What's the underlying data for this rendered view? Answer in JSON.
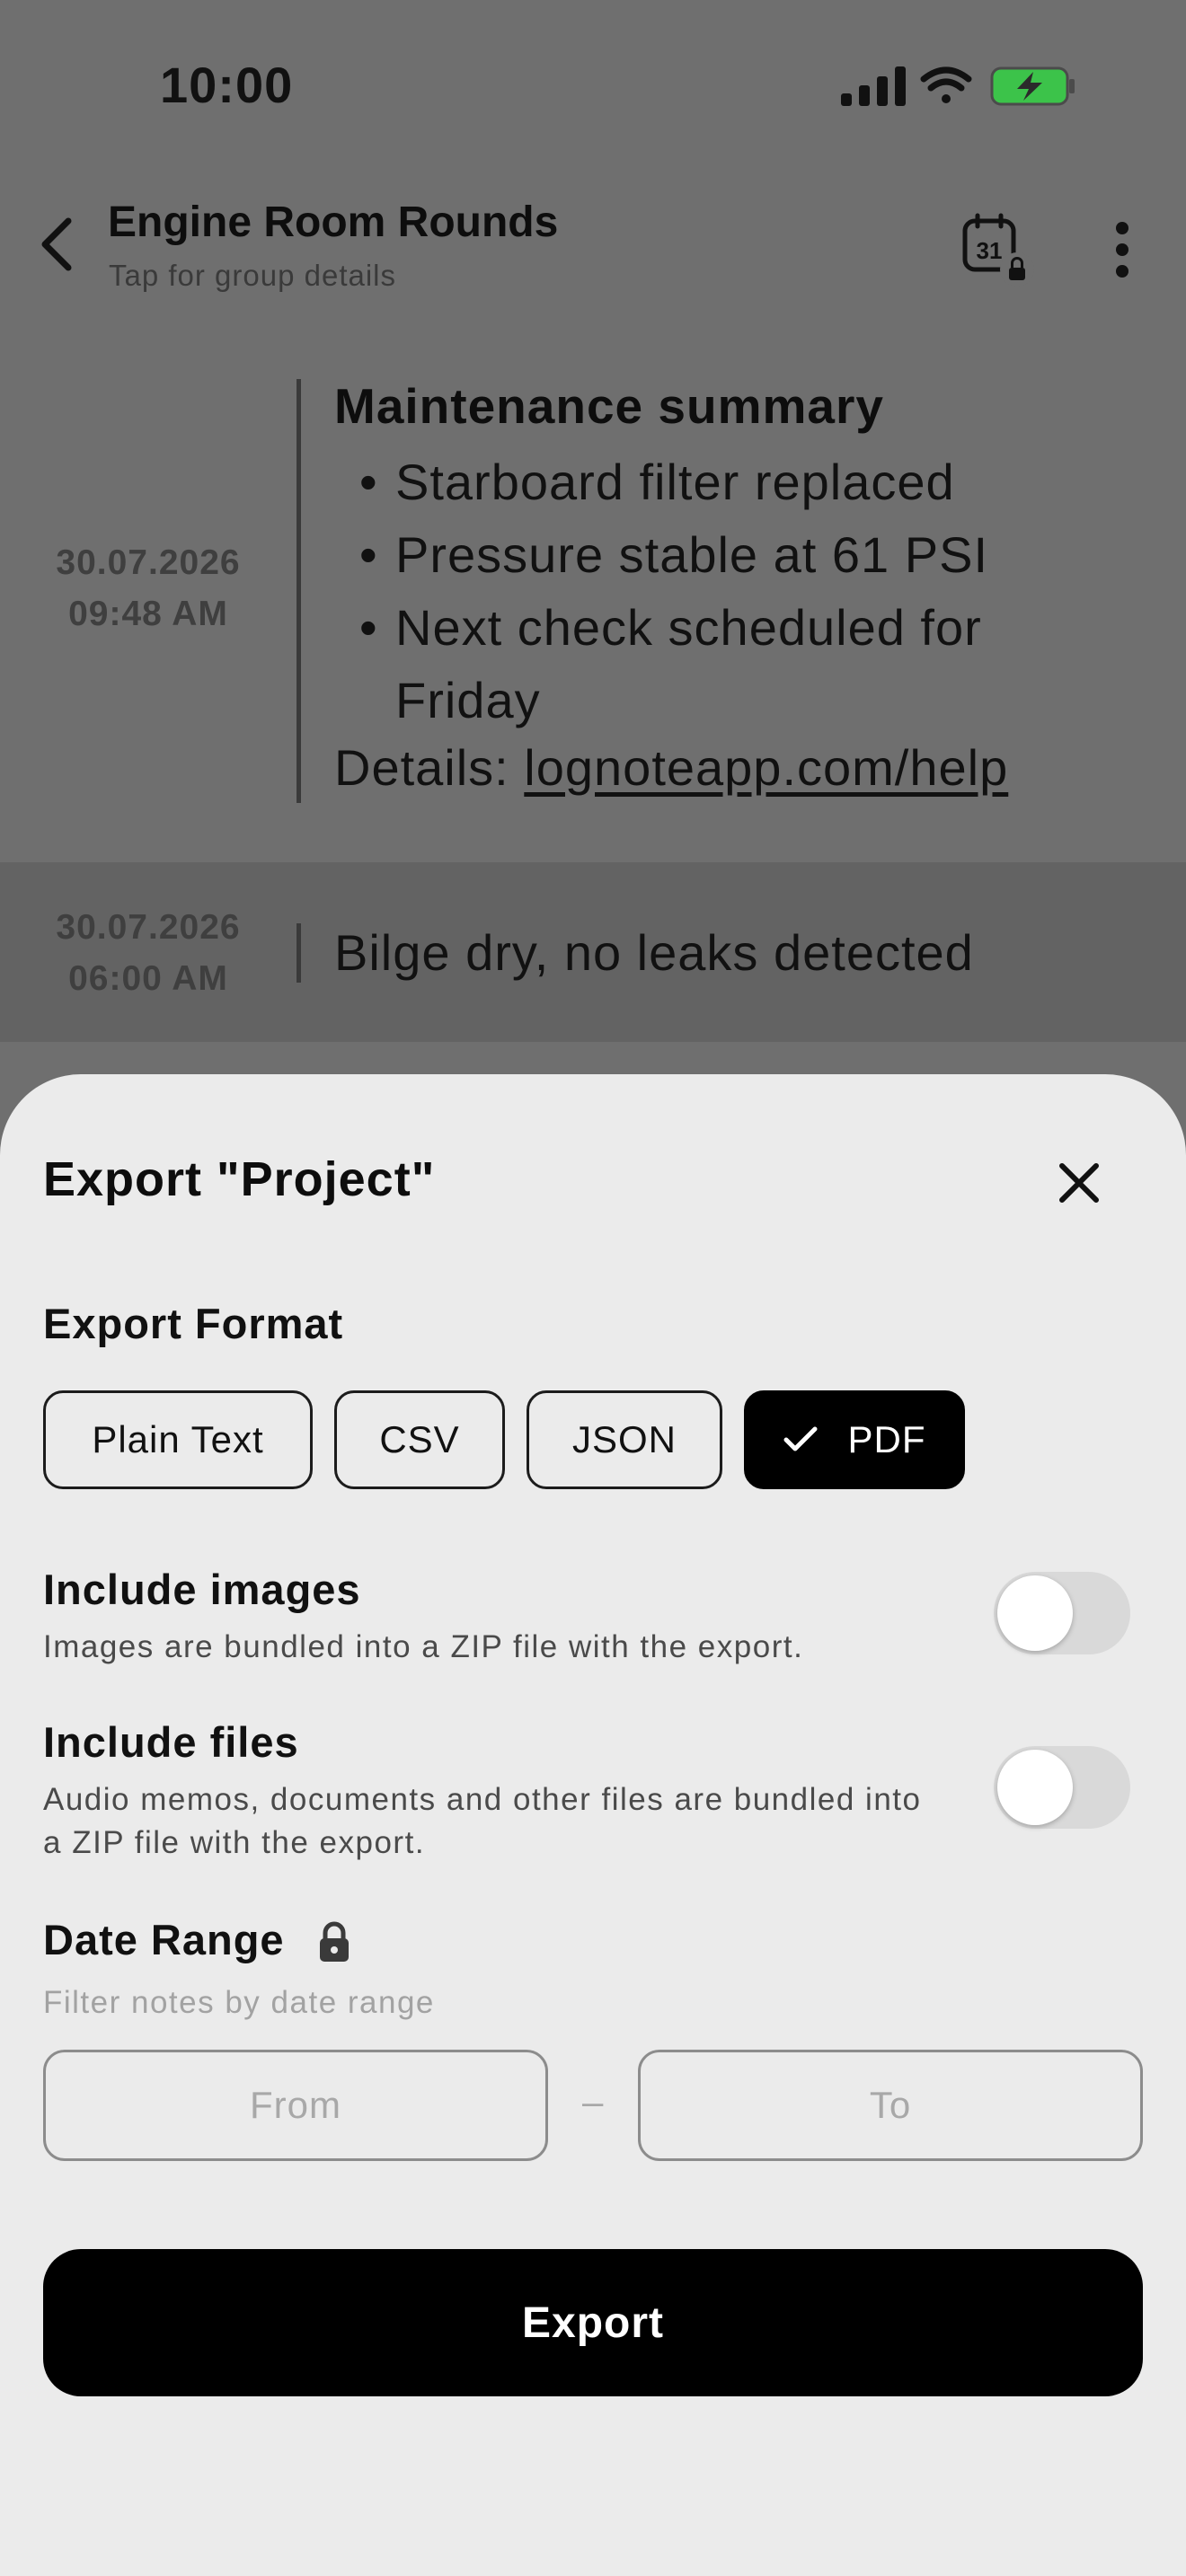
{
  "status_bar": {
    "time": "10:00"
  },
  "header": {
    "title": "Engine Room Rounds",
    "subtitle": "Tap for group details",
    "calendar_day": "31"
  },
  "notes": [
    {
      "date": "30.07.2026",
      "time": "09:48 AM",
      "title": "Maintenance summary",
      "bullets": [
        "Starboard filter replaced",
        "Pressure stable at 61 PSI",
        "Next check scheduled for Friday"
      ],
      "details_prefix": "Details: ",
      "details_link": "lognoteapp.com/help"
    },
    {
      "date": "30.07.2026",
      "time": "06:00 AM",
      "text": "Bilge dry, no leaks detected"
    }
  ],
  "export_sheet": {
    "title": "Export \"Project\"",
    "format_label": "Export Format",
    "formats": [
      "Plain Text",
      "CSV",
      "JSON",
      "PDF"
    ],
    "selected_format": "PDF",
    "include_images": {
      "title": "Include images",
      "description": "Images are bundled into a ZIP file with the export.",
      "enabled": false
    },
    "include_files": {
      "title": "Include files",
      "description": "Audio memos, documents and other files are bundled into a ZIP file with the export.",
      "enabled": false
    },
    "date_range": {
      "label": "Date Range",
      "description": "Filter notes by date range",
      "from_placeholder": "From",
      "to_placeholder": "To",
      "separator": "–",
      "locked": true
    },
    "export_button": "Export"
  },
  "colors": {
    "overlay_background": "#6f6f6f",
    "sheet_background": "#ebebeb",
    "accent": "#000000",
    "battery_charge": "#3cc34a"
  }
}
